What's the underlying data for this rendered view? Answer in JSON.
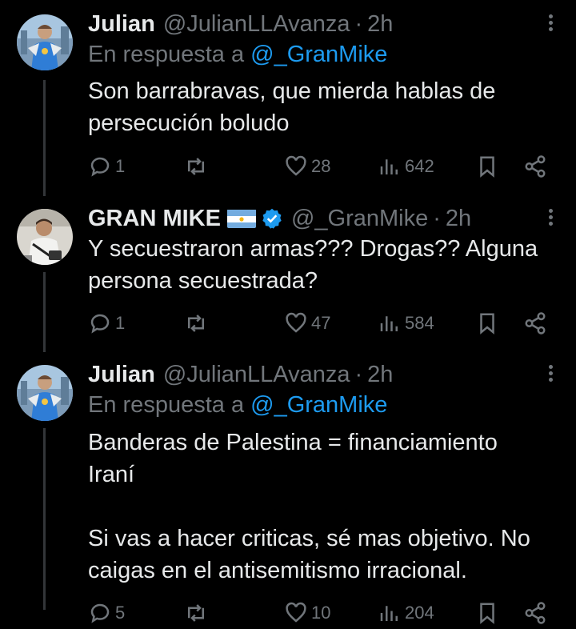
{
  "tweets": [
    {
      "name": "Julian",
      "handle": "@JulianLLAvanza",
      "separator": "·",
      "time": "2h",
      "reply_prefix": "En respuesta a",
      "reply_mention": "@_GranMike",
      "text": "Son barrabravas, que mierda hablas de\npersecución boludo",
      "replies": "1",
      "retweets": "",
      "likes": "28",
      "views": "642"
    },
    {
      "name": "GRAN MIKE",
      "flag": "argentina-flag",
      "verified": "verified-badge",
      "handle": "@_GranMike",
      "separator": "·",
      "time": "2h",
      "text": "Y secuestraron armas??? Drogas?? Alguna\npersona secuestrada?",
      "replies": "1",
      "retweets": "",
      "likes": "47",
      "views": "584"
    },
    {
      "name": "Julian",
      "handle": "@JulianLLAvanza",
      "separator": "·",
      "time": "2h",
      "reply_prefix": "En respuesta a",
      "reply_mention": "@_GranMike",
      "text": "Banderas de Palestina = financiamiento\nIraní\n\nSi vas a hacer criticas, sé mas objetivo. No\ncaigas en el antisemitismo irracional.",
      "replies": "5",
      "retweets": "",
      "likes": "10",
      "views": "204"
    }
  ],
  "icons": {
    "reply": "reply-icon",
    "retweet": "retweet-icon",
    "like": "heart-icon",
    "views": "views-icon",
    "bookmark": "bookmark-icon",
    "share": "share-icon",
    "more": "more-icon"
  },
  "colors": {
    "background": "#000000",
    "text": "#e7e9ea",
    "secondary": "#71767b",
    "accent": "#1d9bf0"
  }
}
